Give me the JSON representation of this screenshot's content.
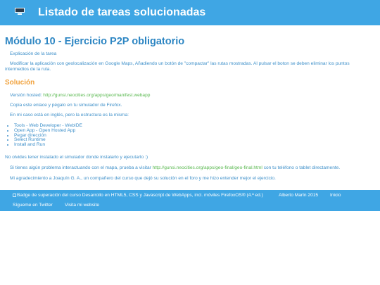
{
  "header": {
    "title": "Listado de tareas solucionadas"
  },
  "module": {
    "title": "Módulo 10 - Ejercicio P2P obligatorio",
    "explanation_label": "Explicación de la tarea",
    "description": "Modificar la aplicación con geolocalización en Google Maps, Añadiendo un botón de \"compactar\" las rutas mostradas. Al pulsar el boton se deben eliminar los puntos intermedios de la ruta."
  },
  "solution": {
    "title": "Solución",
    "hosted_label": "Versión hosted: ",
    "hosted_url": "http://gunsi.neocities.org/apps/geo/manifest.webapp",
    "copy_text": "Copia este enlace y pégalo en tu simulador de Firefox.",
    "english_note": "En mi caso está en inglés, pero la estructura es la misma:",
    "steps": [
      "Tools - Web Developer - WebIDE",
      "Open App - Open Hosted App",
      "Pegar dirección",
      "Select Runtime",
      "Install and Run"
    ],
    "reminder": "No olvides tener instalado el simulador donde instalarlo y ejecutarlo :)",
    "problem_text_before": "Si tienes algún problema interactuando con el mapa, prueba a visitar ",
    "problem_url": "http://gunsi.neocities.org/apps/geo-final/geo-final.html",
    "problem_text_after": " con tu teléfono o tablet directamente.",
    "thanks": "Mi agradecimiento a Joaquín G. A., un compañero del curso que dejó su solución en el foro y me hizo entender mejor el ejercicio."
  },
  "footer": {
    "badge_alt": "Badge de superación del curso Desarrollo en HTML5, CSS y Javascript de WebApps, incl. móviles FirefoxOS® (4.ª ed.)",
    "author": "Alberto Marín 2015",
    "home_link": "Inicio",
    "twitter_link": "Sígueme en Twitter",
    "website_link": "Visita mi website"
  }
}
